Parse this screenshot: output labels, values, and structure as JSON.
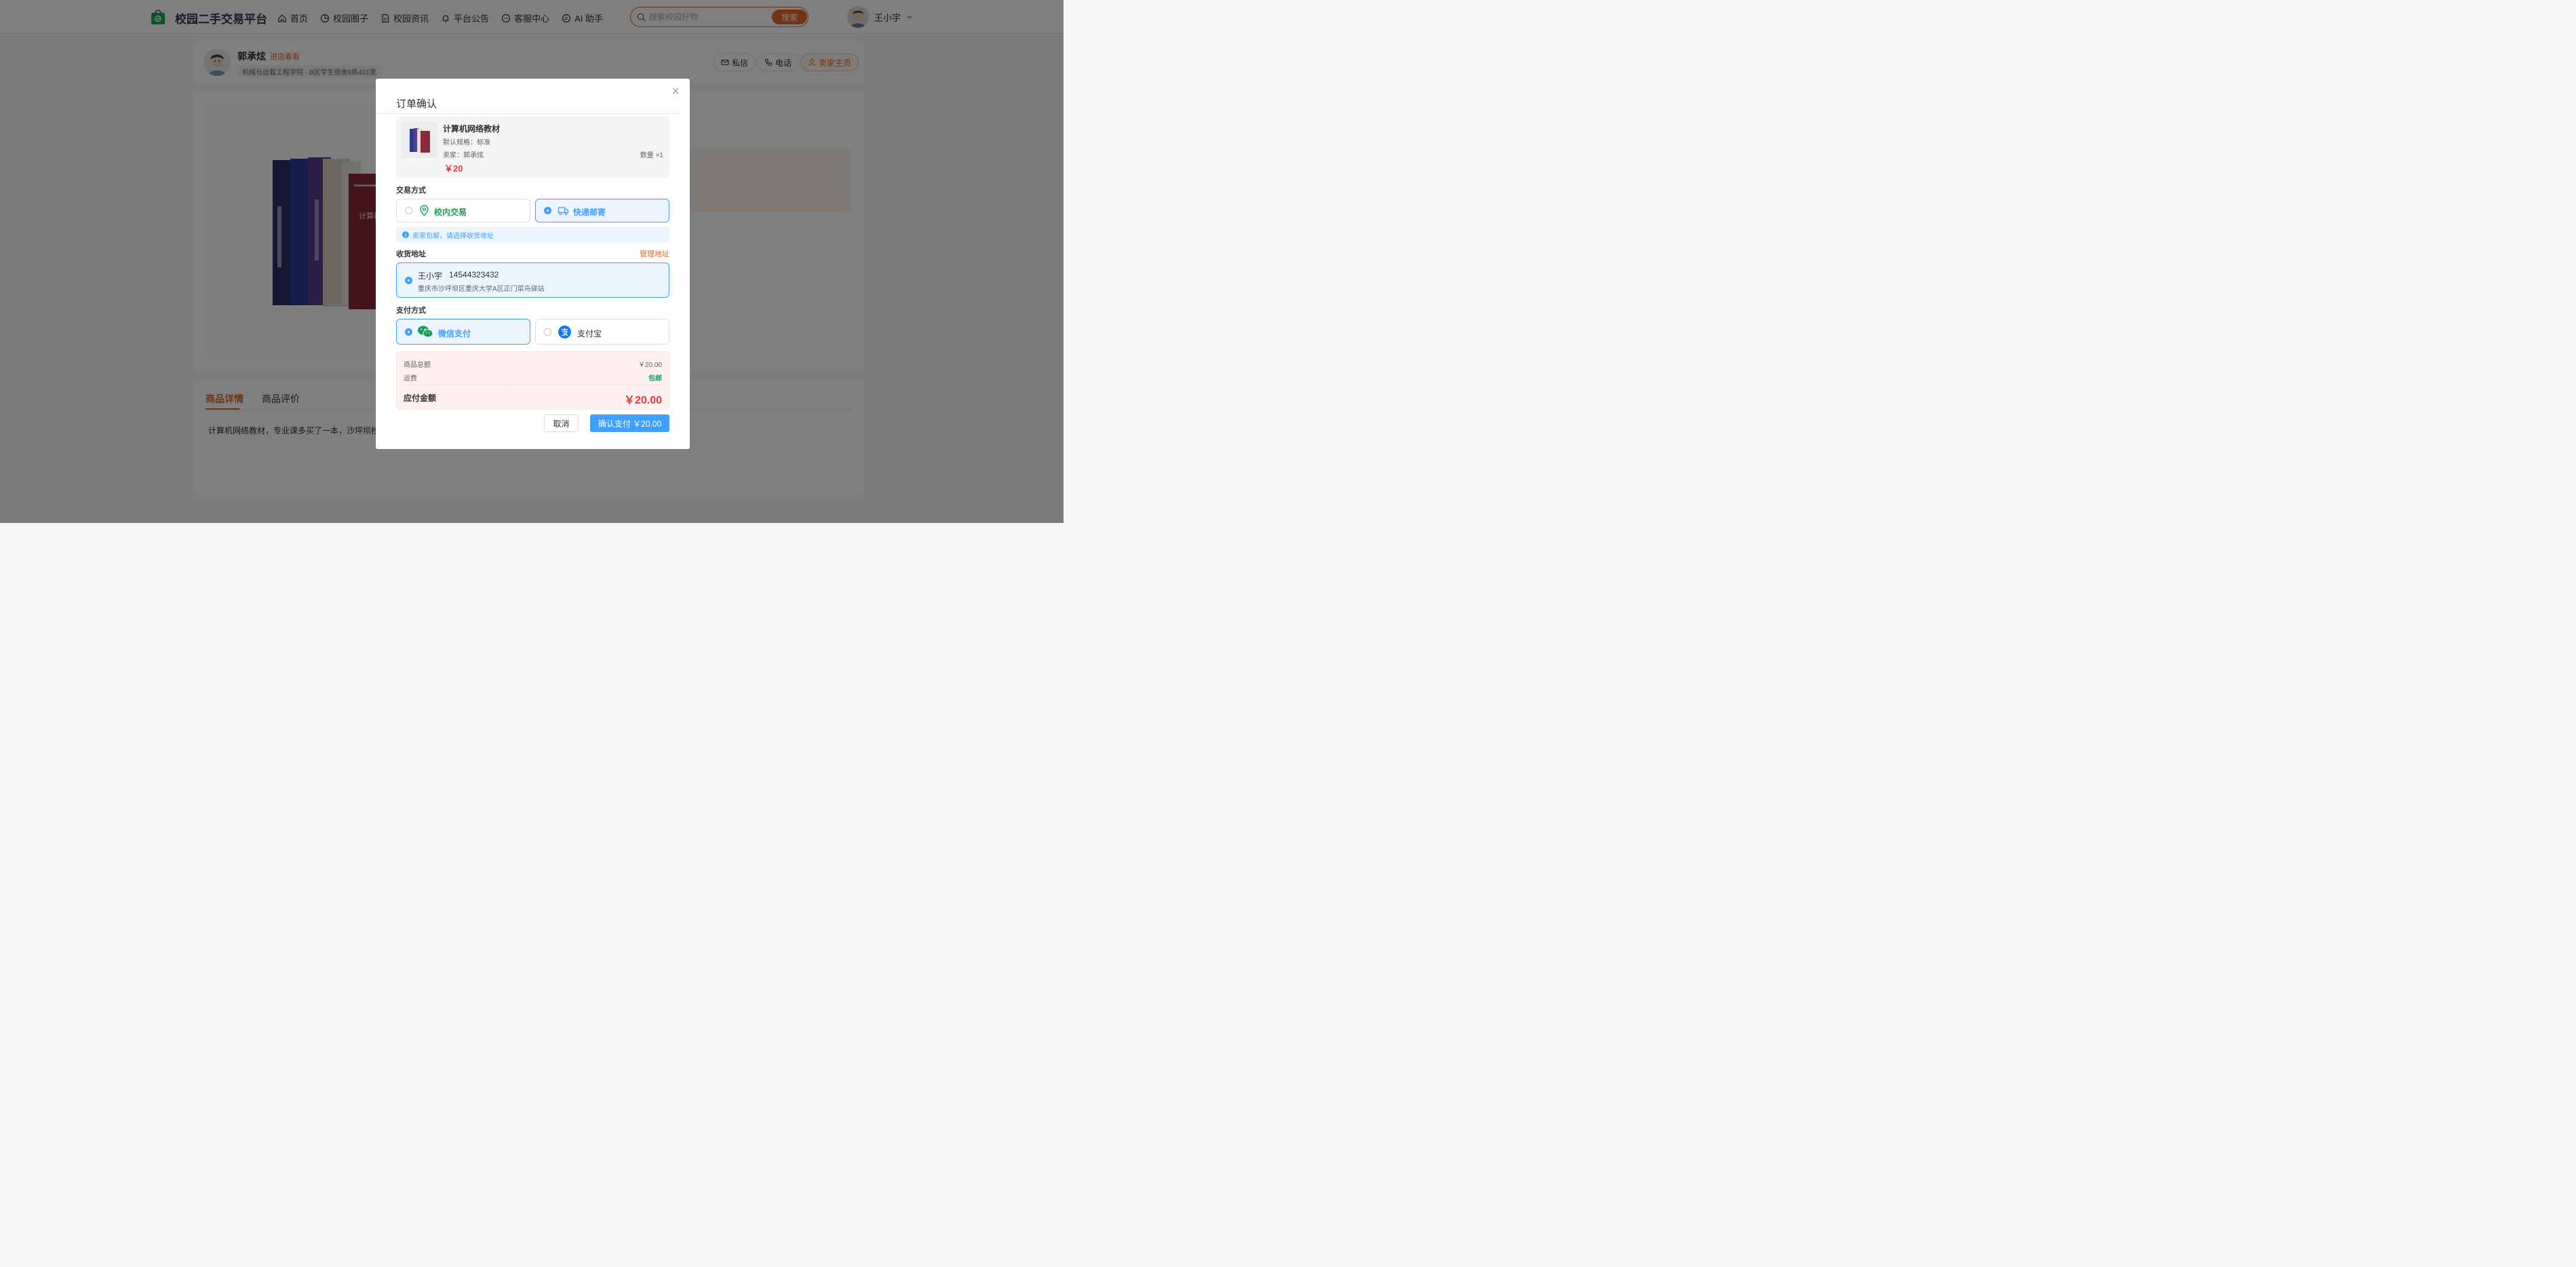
{
  "header": {
    "brand": "校园二手交易平台",
    "nav": [
      {
        "label": "首页",
        "icon": "home-icon"
      },
      {
        "label": "校园圈子",
        "icon": "pie-chart-icon"
      },
      {
        "label": "校园资讯",
        "icon": "document-icon"
      },
      {
        "label": "平台公告",
        "icon": "bell-icon"
      },
      {
        "label": "客服中心",
        "icon": "chat-icon"
      },
      {
        "label": "AI 助手",
        "icon": "chat-icon"
      }
    ],
    "search_placeholder": "搜索校园好物",
    "search_button": "搜索",
    "user_name": "王小宇"
  },
  "seller": {
    "name": "郭承炫",
    "shop_link": "进店看看",
    "tag": "机械与运载工程学院 · B区学生宿舍8栋401室",
    "actions": [
      "私信",
      "电话",
      "卖家主页"
    ]
  },
  "product_tabs": [
    "商品详情",
    "商品评价"
  ],
  "product_description": "计算机网络教材，专业课多买了一本，沙坪坝校区",
  "modal": {
    "title": "订单确认",
    "item": {
      "name": "计算机网络教材",
      "spec": "默认规格：标准",
      "seller": "卖家：郭承炫",
      "quantity": "数量 ×1",
      "price": "￥20"
    },
    "trade_label": "交易方式",
    "trade_options": [
      {
        "label": "校内交易",
        "selected": false,
        "icon": "location-pin-icon"
      },
      {
        "label": "快递邮寄",
        "selected": true,
        "icon": "truck-icon"
      }
    ],
    "trade_notice": "卖家包邮，请选择收货地址",
    "address_label": "收货地址",
    "manage_address": "管理地址",
    "address": {
      "name": "王小宇",
      "phone": "14544323432",
      "detail": "重庆市沙坪坝区重庆大学A区正门菜鸟驿站"
    },
    "payment_label": "支付方式",
    "payment_options": [
      {
        "label": "微信支付",
        "selected": true,
        "icon": "wechat-icon"
      },
      {
        "label": "支付宝",
        "selected": false,
        "icon": "alipay-icon"
      }
    ],
    "summary": {
      "goods_label": "商品总额",
      "goods_value": "￥20.00",
      "shipping_label": "运费",
      "shipping_value": "包邮",
      "total_label": "应付金额",
      "total_value": "￥20.00"
    },
    "cancel": "取消",
    "confirm": "确认支付 ￥20.00"
  },
  "colors": {
    "accent": "#e6662a",
    "primary": "#409eff",
    "price": "#e4393c",
    "success": "#18a058",
    "overlay": "rgba(0,0,0,0.5)"
  }
}
